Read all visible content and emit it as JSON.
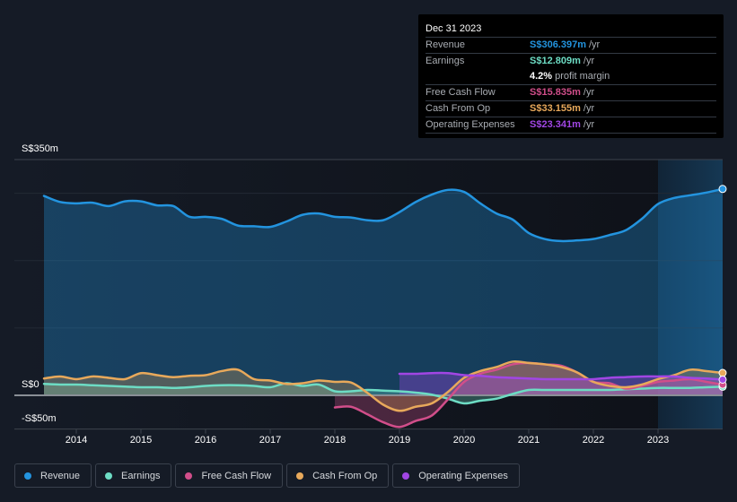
{
  "tooltip": {
    "date": "Dec 31 2023",
    "rows": [
      {
        "label": "Revenue",
        "value": "S$306.397m",
        "unit": "/yr",
        "color": "#2394df"
      },
      {
        "label": "Earnings",
        "value": "S$12.809m",
        "unit": "/yr",
        "color": "#6ddcc4"
      },
      {
        "label": "",
        "value": "4.2%",
        "unit": "profit margin",
        "color": "#ffffff"
      },
      {
        "label": "Free Cash Flow",
        "value": "S$15.835m",
        "unit": "/yr",
        "color": "#d14e8a"
      },
      {
        "label": "Cash From Op",
        "value": "S$33.155m",
        "unit": "/yr",
        "color": "#e8a95b"
      },
      {
        "label": "Operating Expenses",
        "value": "S$23.341m",
        "unit": "/yr",
        "color": "#a146e4"
      }
    ]
  },
  "chart_data": {
    "type": "line",
    "title": "",
    "xlabel": "",
    "ylabel": "",
    "currency": "S$",
    "ylim": [
      -50,
      350
    ],
    "y_ticks": [
      {
        "value": 350,
        "label": "S$350m"
      },
      {
        "value": 0,
        "label": "S$0"
      },
      {
        "value": -50,
        "label": "-S$50m"
      }
    ],
    "gridlines": [
      350,
      300,
      200,
      100,
      0,
      -50
    ],
    "x_ticks": [
      "2014",
      "2015",
      "2016",
      "2017",
      "2018",
      "2019",
      "2020",
      "2021",
      "2022",
      "2023"
    ],
    "xlim": [
      2013.4,
      2024.0
    ],
    "forecast_region_start": 2023.0,
    "grid": true,
    "legend_position": "bottom-left",
    "series": [
      {
        "name": "Revenue",
        "color": "#2394df",
        "x": [
          2013.5,
          2013.75,
          2014.0,
          2014.25,
          2014.5,
          2014.75,
          2015.0,
          2015.25,
          2015.5,
          2015.75,
          2016.0,
          2016.25,
          2016.5,
          2016.75,
          2017.0,
          2017.25,
          2017.5,
          2017.75,
          2018.0,
          2018.25,
          2018.5,
          2018.75,
          2019.0,
          2019.25,
          2019.5,
          2019.75,
          2020.0,
          2020.25,
          2020.5,
          2020.75,
          2021.0,
          2021.25,
          2021.5,
          2021.75,
          2022.0,
          2022.25,
          2022.5,
          2022.75,
          2023.0,
          2023.25,
          2023.5,
          2023.75,
          2024.0
        ],
        "values": [
          296,
          287,
          285,
          286,
          281,
          288,
          288,
          282,
          281,
          265,
          265,
          262,
          252,
          251,
          250,
          258,
          268,
          270,
          265,
          264,
          260,
          260,
          272,
          287,
          298,
          305,
          302,
          285,
          270,
          261,
          241,
          232,
          229,
          230,
          232,
          238,
          245,
          262,
          284,
          293,
          297,
          301,
          306.4
        ]
      },
      {
        "name": "Earnings",
        "color": "#6ddcc4",
        "x": [
          2013.5,
          2013.75,
          2014.0,
          2014.25,
          2014.5,
          2014.75,
          2015.0,
          2015.25,
          2015.5,
          2015.75,
          2016.0,
          2016.25,
          2016.5,
          2016.75,
          2017.0,
          2017.25,
          2017.5,
          2017.75,
          2018.0,
          2018.25,
          2018.5,
          2018.75,
          2019.0,
          2019.25,
          2019.5,
          2019.75,
          2020.0,
          2020.25,
          2020.5,
          2020.75,
          2021.0,
          2021.25,
          2021.5,
          2021.75,
          2022.0,
          2022.25,
          2022.5,
          2022.75,
          2023.0,
          2023.25,
          2023.5,
          2023.75,
          2024.0
        ],
        "values": [
          17,
          16,
          16,
          15,
          14,
          13,
          12,
          12,
          11,
          12,
          14,
          15,
          15,
          14,
          12,
          18,
          14,
          16,
          6,
          6,
          8,
          7,
          6,
          4,
          1,
          -5,
          -12,
          -8,
          -5,
          2,
          8,
          8,
          8,
          8,
          8,
          8,
          9,
          10,
          11,
          11,
          11,
          12,
          12.8
        ]
      },
      {
        "name": "Free Cash Flow",
        "color": "#d14e8a",
        "x": [
          2018.0,
          2018.25,
          2018.5,
          2018.75,
          2019.0,
          2019.25,
          2019.5,
          2019.75,
          2020.0,
          2020.25,
          2020.5,
          2020.75,
          2021.0,
          2021.25,
          2021.5,
          2021.75,
          2022.0,
          2022.25,
          2022.5,
          2022.75,
          2023.0,
          2023.25,
          2023.5,
          2023.75,
          2024.0
        ],
        "values": [
          -18,
          -17,
          -28,
          -40,
          -47,
          -38,
          -30,
          -6,
          20,
          32,
          38,
          46,
          48,
          46,
          44,
          34,
          20,
          18,
          10,
          14,
          20,
          22,
          24,
          20,
          15.8
        ]
      },
      {
        "name": "Cash From Op",
        "color": "#e8a95b",
        "x": [
          2013.5,
          2013.75,
          2014.0,
          2014.25,
          2014.5,
          2014.75,
          2015.0,
          2015.25,
          2015.5,
          2015.75,
          2016.0,
          2016.25,
          2016.5,
          2016.75,
          2017.0,
          2017.25,
          2017.5,
          2017.75,
          2018.0,
          2018.25,
          2018.5,
          2018.75,
          2019.0,
          2019.25,
          2019.5,
          2019.75,
          2020.0,
          2020.25,
          2020.5,
          2020.75,
          2021.0,
          2021.25,
          2021.5,
          2021.75,
          2022.0,
          2022.25,
          2022.5,
          2022.75,
          2023.0,
          2023.25,
          2023.5,
          2023.75,
          2024.0
        ],
        "values": [
          25,
          28,
          24,
          28,
          26,
          24,
          33,
          30,
          27,
          29,
          30,
          36,
          38,
          24,
          22,
          17,
          18,
          22,
          20,
          19,
          4,
          -14,
          -23,
          -17,
          -12,
          5,
          26,
          36,
          42,
          50,
          48,
          46,
          42,
          34,
          20,
          14,
          12,
          16,
          24,
          30,
          38,
          36,
          33.2
        ]
      },
      {
        "name": "Operating Expenses",
        "color": "#a146e4",
        "x": [
          2019.0,
          2019.25,
          2019.5,
          2019.75,
          2020.0,
          2020.25,
          2020.5,
          2020.75,
          2021.0,
          2021.25,
          2021.5,
          2021.75,
          2022.0,
          2022.25,
          2022.5,
          2022.75,
          2023.0,
          2023.25,
          2023.5,
          2023.75,
          2024.0
        ],
        "values": [
          32,
          32,
          33,
          33,
          30,
          29,
          27,
          26,
          25,
          24,
          24,
          24,
          24,
          26,
          27,
          28,
          28,
          28,
          26,
          25,
          23.3
        ]
      }
    ]
  },
  "legend": [
    {
      "label": "Revenue",
      "color": "#2394df"
    },
    {
      "label": "Earnings",
      "color": "#6ddcc4"
    },
    {
      "label": "Free Cash Flow",
      "color": "#d14e8a"
    },
    {
      "label": "Cash From Op",
      "color": "#e8a95b"
    },
    {
      "label": "Operating Expenses",
      "color": "#a146e4"
    }
  ]
}
